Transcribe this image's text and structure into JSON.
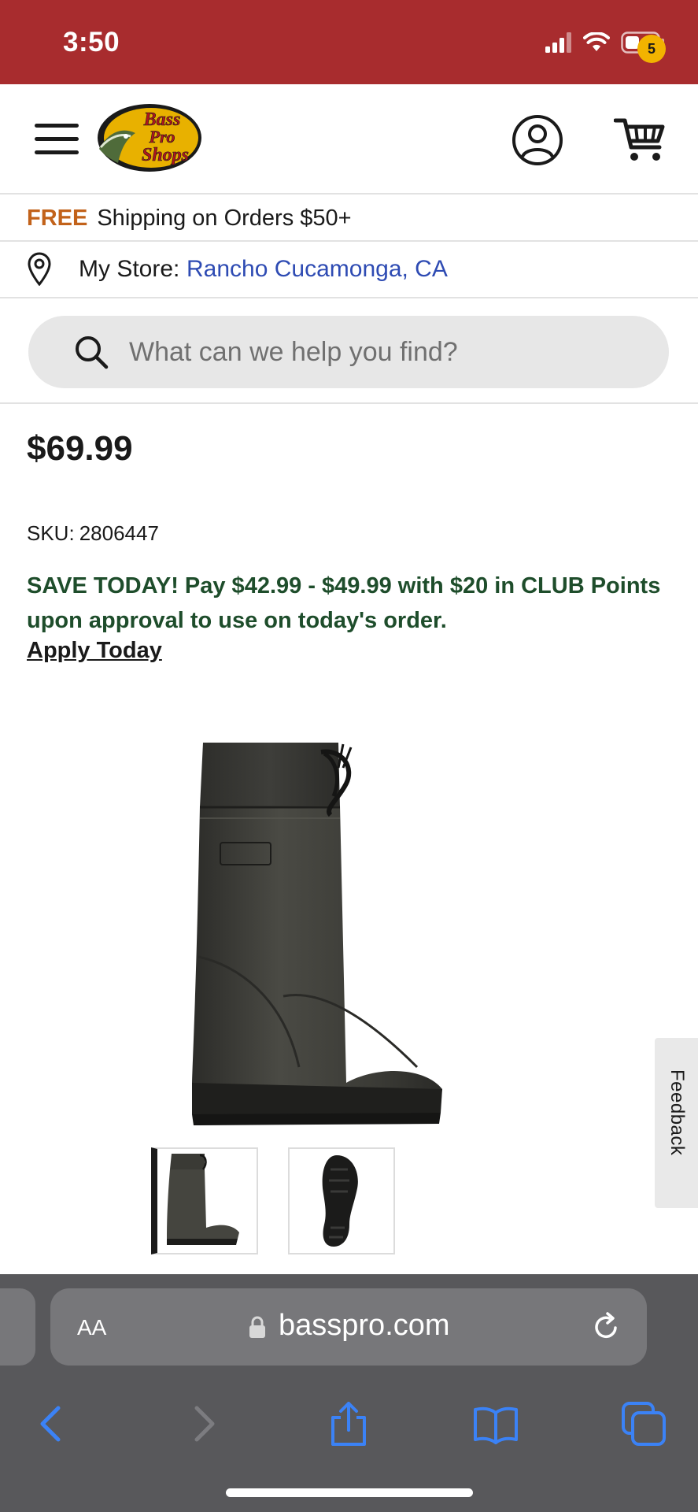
{
  "status_bar": {
    "time": "3:50"
  },
  "header": {
    "logo_text": [
      "Bass",
      "Pro",
      "Shops"
    ],
    "cart_count": "5"
  },
  "promo": {
    "free_label": "FREE",
    "text": "Shipping on Orders $50+"
  },
  "store": {
    "label": "My Store:",
    "name": "Rancho Cucamonga, CA"
  },
  "search": {
    "placeholder": "What can we help you find?"
  },
  "product": {
    "price": "$69.99",
    "sku_label": "SKU:",
    "sku_value": "2806447",
    "save_text": "SAVE TODAY! Pay $42.99 - $49.99 with $20 in CLUB Points upon approval to use on today's order.",
    "apply_link": "Apply Today",
    "image_icon": "boot-image",
    "thumbnails": [
      {
        "icon": "boot-side-thumbnail",
        "selected": true
      },
      {
        "icon": "boot-sole-thumbnail",
        "selected": false
      }
    ]
  },
  "feedback": {
    "label": "Feedback"
  },
  "browser": {
    "aa_label": "AA",
    "url": "basspro.com"
  },
  "colors": {
    "brand_red": "#a82c2e",
    "free_orange": "#c2621a",
    "store_link_blue": "#2e4bb3",
    "save_green": "#1e4d2b",
    "cart_badge_yellow": "#f2b300",
    "browser_gray": "#58585b",
    "ios_blue": "#3b82f6"
  }
}
